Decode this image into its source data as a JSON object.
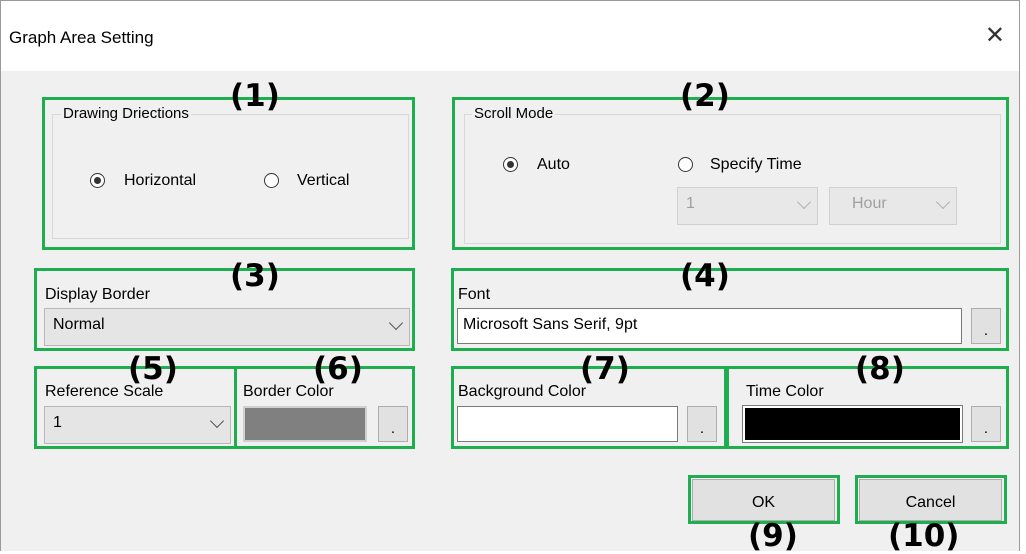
{
  "window": {
    "title": "Graph Area Setting",
    "close_glyph": "✕"
  },
  "annotations": [
    "(1)",
    "(2)",
    "(3)",
    "(4)",
    "(5)",
    "(6)",
    "(7)",
    "(8)",
    "(9)",
    "(10)"
  ],
  "drawing_directions": {
    "legend": "Drawing Driections",
    "options": [
      {
        "label": "Horizontal",
        "selected": true
      },
      {
        "label": "Vertical",
        "selected": false
      }
    ]
  },
  "scroll_mode": {
    "legend": "Scroll Mode",
    "options": [
      {
        "label": "Auto",
        "selected": true
      },
      {
        "label": "Specify Time",
        "selected": false
      }
    ],
    "time_value": "1",
    "time_unit": "Hour"
  },
  "display_border": {
    "label": "Display Border",
    "value": "Normal"
  },
  "font": {
    "label": "Font",
    "value": "Microsoft Sans Serif, 9pt",
    "browse": "."
  },
  "reference_scale": {
    "label": "Reference Scale",
    "value": "1"
  },
  "border_color": {
    "label": "Border Color",
    "color": "#808080",
    "browse": "."
  },
  "background_color": {
    "label": "Background Color",
    "color": "#ffffff",
    "browse": "."
  },
  "time_color": {
    "label": "Time Color",
    "color": "#000000",
    "browse": "."
  },
  "buttons": {
    "ok": "OK",
    "cancel": "Cancel"
  },
  "colors": {
    "highlight": "#1fae4f",
    "dialog_bg": "#f0f0f0"
  }
}
